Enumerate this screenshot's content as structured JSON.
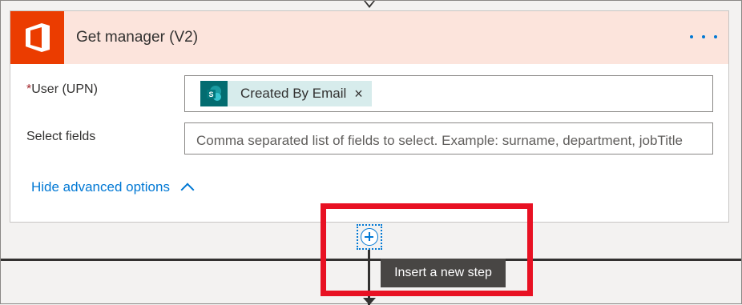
{
  "action_card": {
    "title": "Get manager (V2)",
    "icon": "office-logo-icon",
    "brand_color": "#eb3c00",
    "header_color": "#fce4dc",
    "more_icon": "more-options-icon"
  },
  "fields": {
    "user": {
      "required_mark": "*",
      "label": "User (UPN)",
      "token": {
        "icon": "sharepoint-icon",
        "text": "Created By Email",
        "remove": "×"
      }
    },
    "select_fields": {
      "label": "Select fields",
      "placeholder": "Comma separated list of fields to select. Example: surname, department, jobTitle"
    }
  },
  "advanced_link": "Hide advanced options",
  "insert_step": {
    "icon": "add-step-icon",
    "tooltip": "Insert a new step"
  },
  "colors": {
    "accent": "#0078d4",
    "highlight": "#e81123"
  }
}
